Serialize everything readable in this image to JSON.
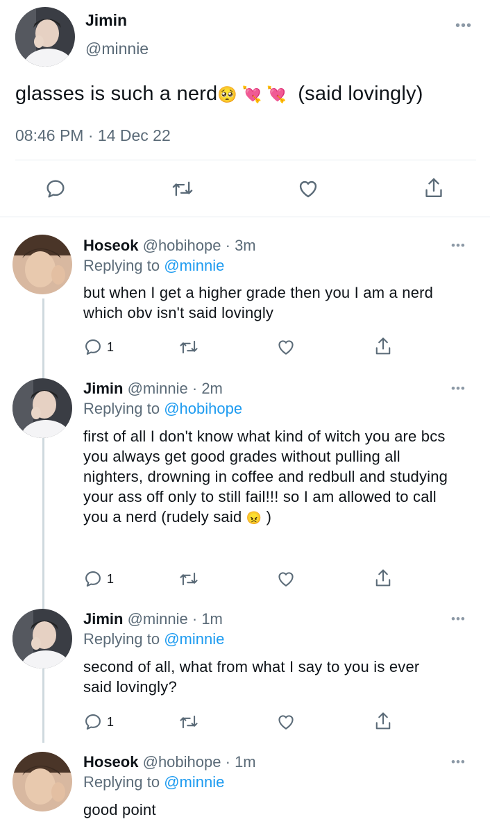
{
  "main_tweet": {
    "name": "Jimin",
    "handle": "@minnie",
    "text": "glasses is such a nerd",
    "emoji": "🥺 💘 💘",
    "text_after": "(said lovingly)",
    "time": "08:46 PM",
    "date": "14 Dec 22",
    "actions": [
      "reply-icon",
      "retweet-icon",
      "like-icon",
      "share-icon"
    ]
  },
  "more_label": "•••",
  "separator": "·",
  "replies": [
    {
      "name": "Hoseok",
      "handle": "@hobihope",
      "time": "3m",
      "replying_prefix": "Replying to",
      "replying_handle": "@minnie",
      "text": "but when I get a higher grade then you I am a nerd which obv isn't said lovingly",
      "reply_count": "1"
    },
    {
      "name": "Jimin",
      "handle": "@minnie",
      "time": "2m",
      "replying_prefix": "Replying to",
      "replying_handle": "@hobihope",
      "text": "first of all I don't know what kind of witch you are bcs you always get good grades without pulling all nighters, drowning in coffee and redbull and studying your ass off only to still fail!!! so I am allowed to call you a nerd (rudely said",
      "text_emoji": "😠",
      "text_end": ")",
      "reply_count": "1"
    },
    {
      "name": "Jimin",
      "handle": "@minnie",
      "time": "1m",
      "replying_prefix": "Replying to",
      "replying_handle": "@minnie",
      "text": "second of all, what from what I say to you is ever said lovingly?",
      "reply_count": "1"
    },
    {
      "name": "Hoseok",
      "handle": "@hobihope",
      "time": "1m",
      "replying_prefix": "Replying to",
      "replying_handle": "@minnie",
      "text": "good point"
    }
  ]
}
